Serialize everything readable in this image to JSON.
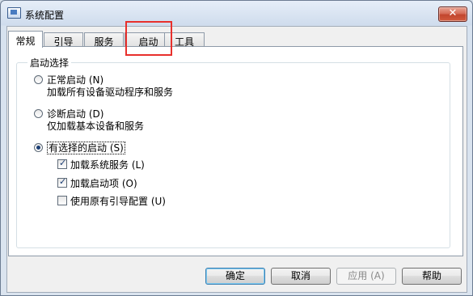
{
  "window": {
    "title": "系统配置",
    "close_label": "✕"
  },
  "tabs": [
    {
      "label": "常规",
      "active": true
    },
    {
      "label": "引导",
      "active": false
    },
    {
      "label": "服务",
      "active": false
    },
    {
      "label": "启动",
      "active": false
    },
    {
      "label": "工具",
      "active": false
    }
  ],
  "startup_selection": {
    "group_label": "启动选择",
    "normal": {
      "label": "正常启动 (N)",
      "desc": "加载所有设备驱动程序和服务",
      "checked": false
    },
    "diagnostic": {
      "label": "诊断启动 (D)",
      "desc": "仅加载基本设备和服务",
      "checked": false
    },
    "selective": {
      "label": "有选择的启动 (S)",
      "checked": true,
      "options": [
        {
          "label": "加载系统服务 (L)",
          "checked": true
        },
        {
          "label": "加载启动项 (O)",
          "checked": true
        },
        {
          "label": "使用原有引导配置 (U)",
          "checked": false
        }
      ]
    }
  },
  "buttons": {
    "ok": "确定",
    "cancel": "取消",
    "apply": "应用 (A)",
    "help": "帮助"
  },
  "colors": {
    "highlight": "#e8302c"
  }
}
